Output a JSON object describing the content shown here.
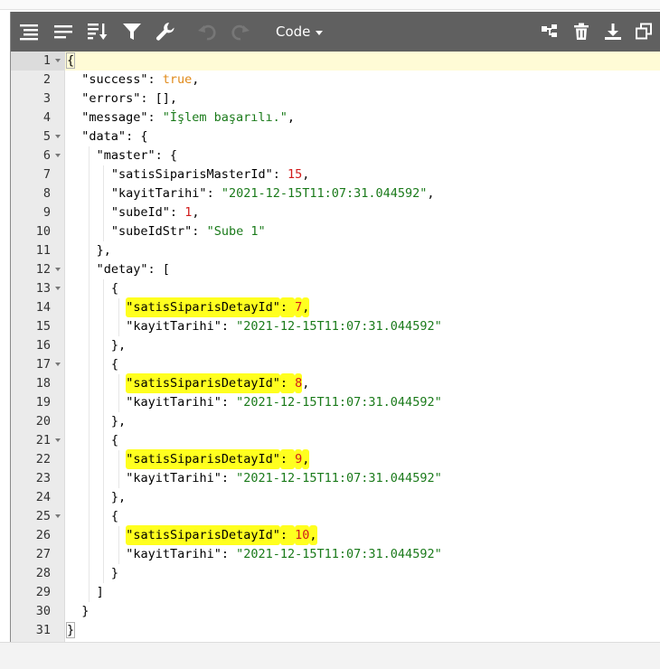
{
  "toolbar": {
    "mode_label": "Code",
    "left_icons": [
      "format-icon",
      "compact-icon",
      "sort-icon",
      "filter-icon",
      "repair-icon",
      "undo-icon",
      "redo-icon"
    ],
    "right_icons": [
      "transform-icon",
      "delete-icon",
      "download-icon",
      "copy-icon"
    ]
  },
  "editor": {
    "active_line": 1,
    "highlight_color": "#ffff1f",
    "lines": [
      {
        "n": "1",
        "fold": true,
        "indent": 0,
        "parts": [
          {
            "t": "{",
            "c": "p",
            "mark": true
          }
        ]
      },
      {
        "n": "2",
        "fold": false,
        "indent": 1,
        "parts": [
          {
            "t": "\"success\"",
            "c": "k"
          },
          {
            "t": ": ",
            "c": "p"
          },
          {
            "t": "true",
            "c": "b"
          },
          {
            "t": ",",
            "c": "p"
          }
        ]
      },
      {
        "n": "3",
        "fold": false,
        "indent": 1,
        "parts": [
          {
            "t": "\"errors\"",
            "c": "k"
          },
          {
            "t": ": [],",
            "c": "p"
          }
        ]
      },
      {
        "n": "4",
        "fold": false,
        "indent": 1,
        "parts": [
          {
            "t": "\"message\"",
            "c": "k"
          },
          {
            "t": ": ",
            "c": "p"
          },
          {
            "t": "\"İşlem başarılı.\"",
            "c": "s"
          },
          {
            "t": ",",
            "c": "p"
          }
        ]
      },
      {
        "n": "5",
        "fold": true,
        "indent": 1,
        "parts": [
          {
            "t": "\"data\"",
            "c": "k"
          },
          {
            "t": ": {",
            "c": "p"
          }
        ]
      },
      {
        "n": "6",
        "fold": true,
        "indent": 2,
        "parts": [
          {
            "t": "\"master\"",
            "c": "k"
          },
          {
            "t": ": {",
            "c": "p"
          }
        ]
      },
      {
        "n": "7",
        "fold": false,
        "indent": 3,
        "parts": [
          {
            "t": "\"satisSiparisMasterId\"",
            "c": "k"
          },
          {
            "t": ": ",
            "c": "p"
          },
          {
            "t": "15",
            "c": "n"
          },
          {
            "t": ",",
            "c": "p"
          }
        ]
      },
      {
        "n": "8",
        "fold": false,
        "indent": 3,
        "parts": [
          {
            "t": "\"kayitTarihi\"",
            "c": "k"
          },
          {
            "t": ": ",
            "c": "p"
          },
          {
            "t": "\"2021-12-15T11:07:31.044592\"",
            "c": "s"
          },
          {
            "t": ",",
            "c": "p"
          }
        ]
      },
      {
        "n": "9",
        "fold": false,
        "indent": 3,
        "parts": [
          {
            "t": "\"subeId\"",
            "c": "k"
          },
          {
            "t": ": ",
            "c": "p"
          },
          {
            "t": "1",
            "c": "n"
          },
          {
            "t": ",",
            "c": "p"
          }
        ]
      },
      {
        "n": "10",
        "fold": false,
        "indent": 3,
        "parts": [
          {
            "t": "\"subeIdStr\"",
            "c": "k"
          },
          {
            "t": ": ",
            "c": "p"
          },
          {
            "t": "\"Sube 1\"",
            "c": "s"
          }
        ]
      },
      {
        "n": "11",
        "fold": false,
        "indent": 2,
        "parts": [
          {
            "t": "},",
            "c": "p"
          }
        ]
      },
      {
        "n": "12",
        "fold": true,
        "indent": 2,
        "parts": [
          {
            "t": "\"detay\"",
            "c": "k"
          },
          {
            "t": ": [",
            "c": "p"
          }
        ]
      },
      {
        "n": "13",
        "fold": true,
        "indent": 3,
        "parts": [
          {
            "t": "{",
            "c": "p"
          }
        ]
      },
      {
        "n": "14",
        "fold": false,
        "indent": 4,
        "parts": [
          {
            "t": "\"satisSiparisDetayId\"",
            "c": "k",
            "hl": true
          },
          {
            "t": ": ",
            "c": "p",
            "hl": true
          },
          {
            "t": "7",
            "c": "n",
            "hl": true
          },
          {
            "t": ",",
            "c": "p",
            "hl": true
          }
        ]
      },
      {
        "n": "15",
        "fold": false,
        "indent": 4,
        "parts": [
          {
            "t": "\"kayitTarihi\"",
            "c": "k"
          },
          {
            "t": ": ",
            "c": "p"
          },
          {
            "t": "\"2021-12-15T11:07:31.044592\"",
            "c": "s"
          }
        ]
      },
      {
        "n": "16",
        "fold": false,
        "indent": 3,
        "parts": [
          {
            "t": "},",
            "c": "p"
          }
        ]
      },
      {
        "n": "17",
        "fold": true,
        "indent": 3,
        "parts": [
          {
            "t": "{",
            "c": "p"
          }
        ]
      },
      {
        "n": "18",
        "fold": false,
        "indent": 4,
        "parts": [
          {
            "t": "\"satisSiparisDetayId\"",
            "c": "k",
            "hl": true
          },
          {
            "t": ": ",
            "c": "p",
            "hl": true
          },
          {
            "t": "8",
            "c": "n",
            "hl": true
          },
          {
            "t": ",",
            "c": "p"
          }
        ]
      },
      {
        "n": "19",
        "fold": false,
        "indent": 4,
        "parts": [
          {
            "t": "\"kayitTarihi\"",
            "c": "k"
          },
          {
            "t": ": ",
            "c": "p"
          },
          {
            "t": "\"2021-12-15T11:07:31.044592\"",
            "c": "s"
          }
        ]
      },
      {
        "n": "20",
        "fold": false,
        "indent": 3,
        "parts": [
          {
            "t": "},",
            "c": "p"
          }
        ]
      },
      {
        "n": "21",
        "fold": true,
        "indent": 3,
        "parts": [
          {
            "t": "{",
            "c": "p"
          }
        ]
      },
      {
        "n": "22",
        "fold": false,
        "indent": 4,
        "parts": [
          {
            "t": "\"satisSiparisDetayId\"",
            "c": "k",
            "hl": true
          },
          {
            "t": ": ",
            "c": "p",
            "hl": true
          },
          {
            "t": "9",
            "c": "n",
            "hl": true
          },
          {
            "t": ",",
            "c": "p",
            "hl": true
          }
        ]
      },
      {
        "n": "23",
        "fold": false,
        "indent": 4,
        "parts": [
          {
            "t": "\"kayitTarihi\"",
            "c": "k"
          },
          {
            "t": ": ",
            "c": "p"
          },
          {
            "t": "\"2021-12-15T11:07:31.044592\"",
            "c": "s"
          }
        ]
      },
      {
        "n": "24",
        "fold": false,
        "indent": 3,
        "parts": [
          {
            "t": "},",
            "c": "p"
          }
        ]
      },
      {
        "n": "25",
        "fold": true,
        "indent": 3,
        "parts": [
          {
            "t": "{",
            "c": "p"
          }
        ]
      },
      {
        "n": "26",
        "fold": false,
        "indent": 4,
        "parts": [
          {
            "t": "\"satisSiparisDetayId\"",
            "c": "k",
            "hl": true
          },
          {
            "t": ": ",
            "c": "p",
            "hl": true
          },
          {
            "t": "10",
            "c": "n",
            "hl": true
          },
          {
            "t": ",",
            "c": "p",
            "hl": true
          }
        ]
      },
      {
        "n": "27",
        "fold": false,
        "indent": 4,
        "parts": [
          {
            "t": "\"kayitTarihi\"",
            "c": "k"
          },
          {
            "t": ": ",
            "c": "p"
          },
          {
            "t": "\"2021-12-15T11:07:31.044592\"",
            "c": "s"
          }
        ]
      },
      {
        "n": "28",
        "fold": false,
        "indent": 3,
        "parts": [
          {
            "t": "}",
            "c": "p"
          }
        ]
      },
      {
        "n": "29",
        "fold": false,
        "indent": 2,
        "parts": [
          {
            "t": "]",
            "c": "p"
          }
        ]
      },
      {
        "n": "30",
        "fold": false,
        "indent": 1,
        "parts": [
          {
            "t": "}",
            "c": "p"
          }
        ]
      },
      {
        "n": "31",
        "fold": false,
        "indent": 0,
        "parts": [
          {
            "t": "}",
            "c": "p",
            "mark": true
          }
        ]
      }
    ]
  }
}
